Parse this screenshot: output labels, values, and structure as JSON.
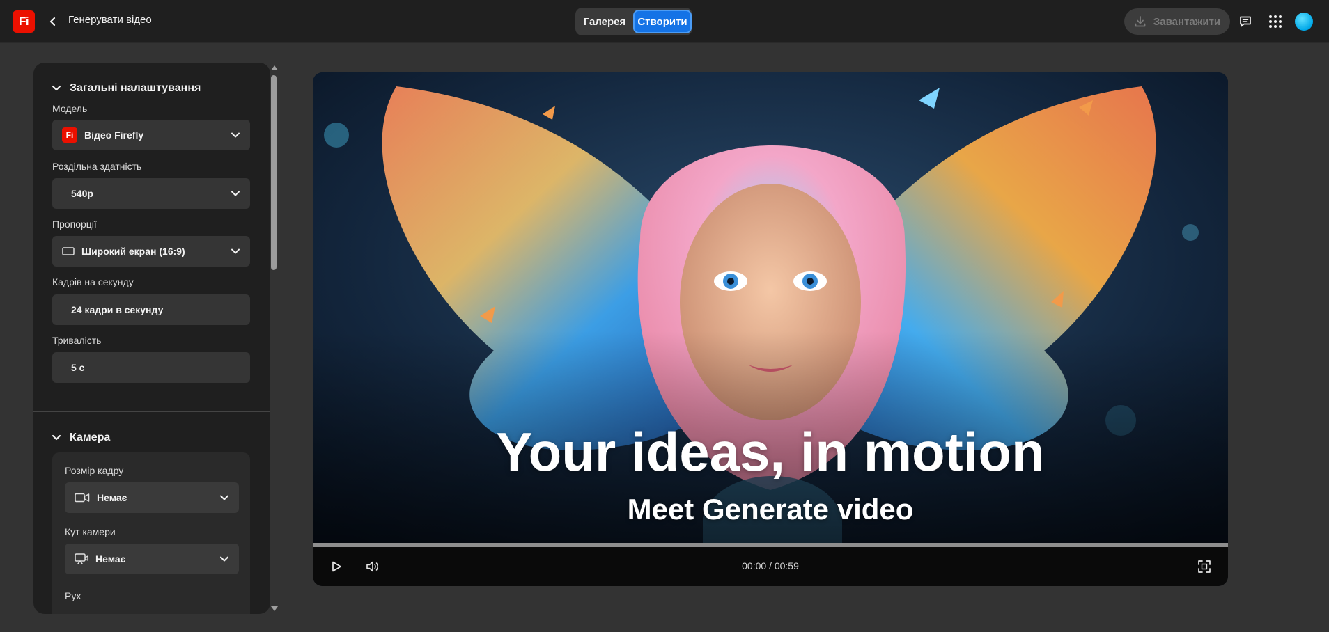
{
  "topbar": {
    "logo": "Fi",
    "back_icon": "chevron-left-icon",
    "title": "Генерувати відео",
    "tabs": [
      {
        "label": "Галерея",
        "active": false
      },
      {
        "label": "Створити",
        "active": true
      }
    ],
    "download_label": "Завантажити",
    "download_icon": "download-icon",
    "icons": [
      "comment-icon",
      "apps-grid-icon",
      "avatar"
    ]
  },
  "panel": {
    "general": {
      "heading": "Загальні налаштування",
      "fields": [
        {
          "label": "Модель",
          "value": "Відео Firefly",
          "icon": "firefly-logo-icon",
          "dropdown": true
        },
        {
          "label": "Роздільна здатність",
          "value": "540p",
          "dropdown": true
        },
        {
          "label": "Пропорції",
          "value": "Широкий екран (16:9)",
          "icon": "widescreen-icon",
          "dropdown": true
        },
        {
          "label": "Кадрів на секунду",
          "value": "24 кадри в секунду",
          "dropdown": false
        },
        {
          "label": "Тривалість",
          "value": "5 с",
          "dropdown": false
        }
      ]
    },
    "camera": {
      "heading": "Камера",
      "fields": [
        {
          "label": "Розмір кадру",
          "value": "Немає",
          "icon": "video-camera-icon",
          "dropdown": true
        },
        {
          "label": "Кут камери",
          "value": "Немає",
          "icon": "camera-angle-icon",
          "dropdown": true
        },
        {
          "label": "Рух"
        }
      ]
    },
    "model_logo": "Fi"
  },
  "video": {
    "headline": "Your ideas, in motion",
    "subline": "Meet Generate video",
    "time": "00:00 / 00:59",
    "progress": 0
  },
  "colors": {
    "accent": "#1473e6",
    "brand": "#eb1000",
    "background": "#333333",
    "panel": "#1f1f1f"
  }
}
